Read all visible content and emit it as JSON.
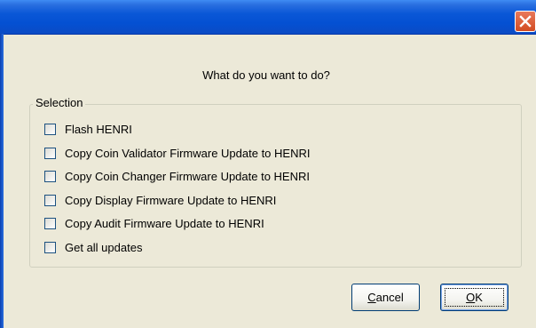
{
  "dialog": {
    "prompt": "What do you want to do?",
    "close_icon": "close-icon",
    "group_label": "Selection",
    "options": [
      {
        "label": "Flash HENRI",
        "checked": false
      },
      {
        "label": "Copy Coin Validator Firmware Update to HENRI",
        "checked": false
      },
      {
        "label": "Copy Coin Changer Firmware Update to HENRI",
        "checked": false
      },
      {
        "label": "Copy Display Firmware Update to HENRI",
        "checked": false
      },
      {
        "label": "Copy Audit Firmware Update to HENRI",
        "checked": false
      },
      {
        "label": "Get all updates",
        "checked": false
      }
    ],
    "buttons": {
      "cancel": {
        "mnemonic": "C",
        "rest": "ancel"
      },
      "ok": {
        "mnemonic": "O",
        "rest": "K"
      }
    }
  },
  "colors": {
    "titlebar": "#0450d2",
    "close": "#d34c22",
    "dialog_bg": "#ece9d8"
  }
}
